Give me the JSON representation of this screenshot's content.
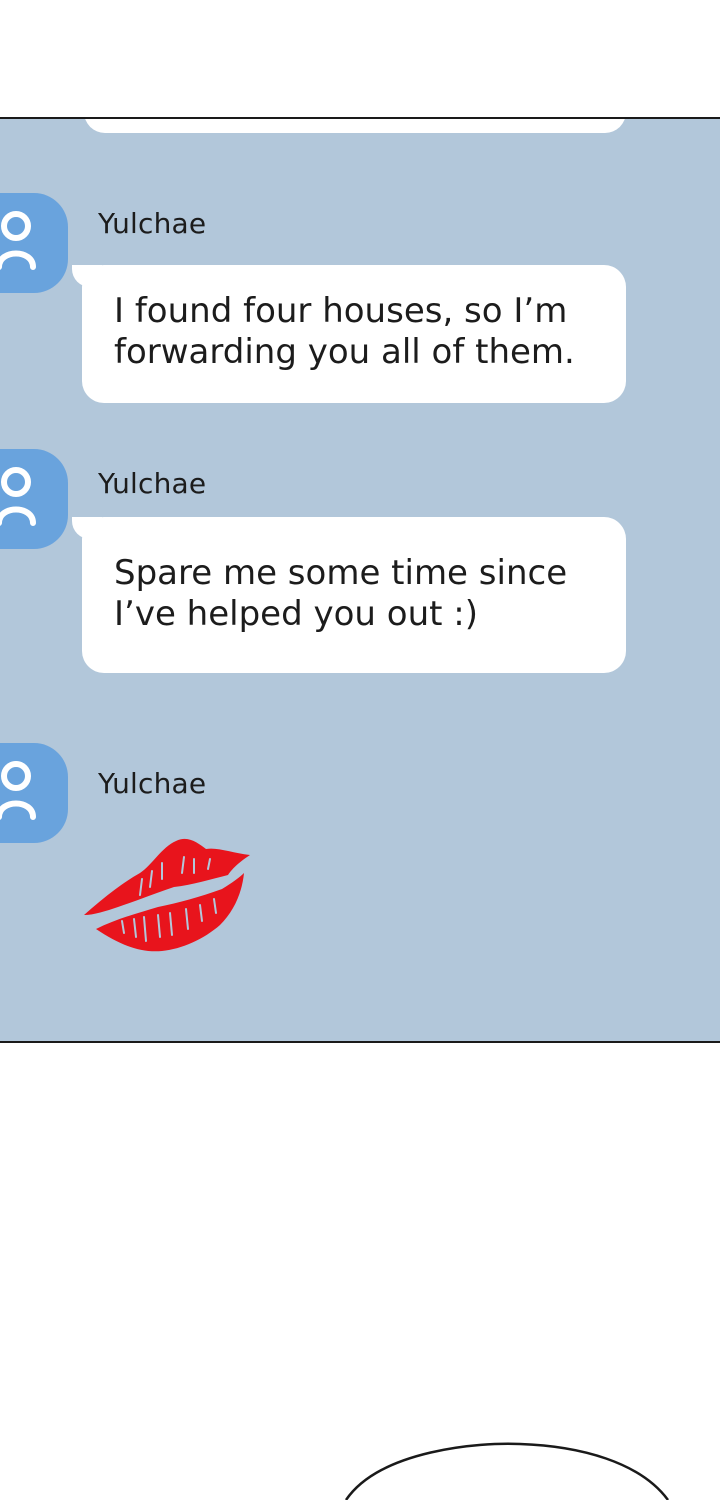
{
  "messages": [
    {
      "sender": "Yulchae",
      "text": "I found four houses, so I’m\nforwarding you all of them."
    },
    {
      "sender": "Yulchae",
      "text": "Spare me some time since\nI’ve helped you out :)"
    },
    {
      "sender": "Yulchae",
      "sticker": "lips-kiss"
    }
  ],
  "colors": {
    "chat_background": "#b2c7da",
    "avatar": "#69a3dd",
    "bubble": "#ffffff",
    "kiss": "#e8141c"
  }
}
